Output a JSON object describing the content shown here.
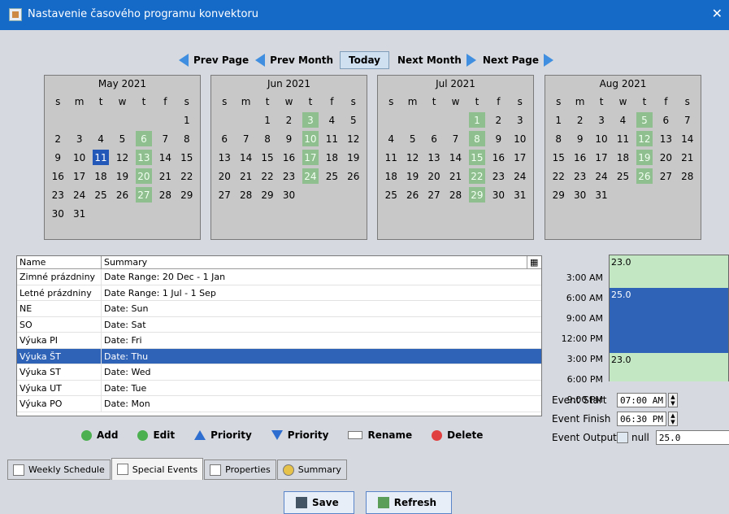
{
  "window": {
    "title": "Nastavenie časového programu konvektoru",
    "close": "✕"
  },
  "nav": {
    "prev_page": "Prev Page",
    "prev_month": "Prev Month",
    "today": "Today",
    "next_month": "Next Month",
    "next_page": "Next Page"
  },
  "weekday_headers": [
    "s",
    "m",
    "t",
    "w",
    "t",
    "f",
    "s"
  ],
  "months": [
    {
      "name": "May 2021",
      "start": 6,
      "days": 31,
      "highlight": [
        6,
        13,
        20,
        27
      ],
      "selected": [
        11
      ]
    },
    {
      "name": "Jun 2021",
      "start": 2,
      "days": 30,
      "highlight": [
        3,
        10,
        17,
        24
      ],
      "selected": []
    },
    {
      "name": "Jul 2021",
      "start": 4,
      "days": 31,
      "highlight": [
        1,
        8,
        15,
        22,
        29
      ],
      "selected": []
    },
    {
      "name": "Aug 2021",
      "start": 0,
      "days": 31,
      "highlight": [
        5,
        12,
        19,
        26
      ],
      "selected": []
    }
  ],
  "table": {
    "col_name": "Name",
    "col_summary": "Summary",
    "rows": [
      {
        "name": "Zimné prázdniny",
        "summary": "Date Range: 20 Dec - 1 Jan"
      },
      {
        "name": "Letné prázdniny",
        "summary": "Date Range: 1 Jul - 1 Sep"
      },
      {
        "name": "NE",
        "summary": "Date: Sun"
      },
      {
        "name": "SO",
        "summary": "Date: Sat"
      },
      {
        "name": "Výuka PI",
        "summary": "Date: Fri"
      },
      {
        "name": "Výuka ŠT",
        "summary": "Date: Thu",
        "selected": true
      },
      {
        "name": "Výuka ST",
        "summary": "Date: Wed"
      },
      {
        "name": "Výuka UT",
        "summary": "Date: Tue"
      },
      {
        "name": "Výuka PO",
        "summary": "Date: Mon"
      }
    ]
  },
  "actions": {
    "add": "Add",
    "edit": "Edit",
    "priority_up": "Priority",
    "priority_down": "Priority",
    "rename": "Rename",
    "delete": "Delete"
  },
  "day_view": {
    "times": [
      "3:00 AM",
      "6:00 AM",
      "9:00 AM",
      "12:00 PM",
      "3:00 PM",
      "6:00 PM",
      "9:00 PM"
    ],
    "block1": "23.0",
    "block2": "25.0",
    "block3": "23.0"
  },
  "event": {
    "start_label": "Event Start",
    "start_value": "07:00 AM",
    "finish_label": "Event Finish",
    "finish_value": "06:30 PM",
    "output_label": "Event Output",
    "null_label": "null",
    "output_value": "25.0"
  },
  "tabs": [
    "Weekly Schedule",
    "Special Events",
    "Properties",
    "Summary"
  ],
  "buttons": {
    "save": "Save",
    "refresh": "Refresh"
  }
}
